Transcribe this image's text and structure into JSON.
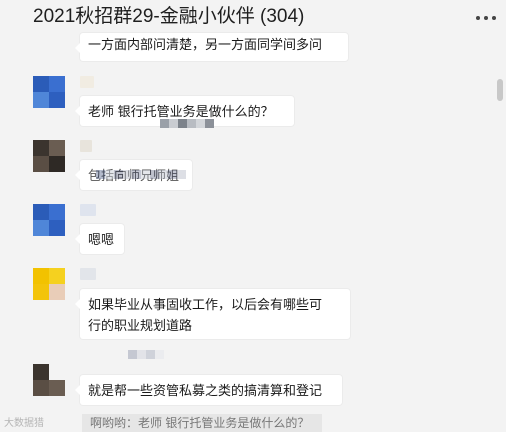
{
  "header": {
    "title": "2021秋招群29-金融小伙伴 (304)",
    "more_icon": "more-dots-icon"
  },
  "messages": [
    {
      "text": "一方面内部问清楚，另一方面同学间多问"
    },
    {
      "text": "老师 银行托管业务是做什么的？"
    },
    {
      "text": "包括向师兄师姐"
    },
    {
      "text": "嗯嗯"
    },
    {
      "text": "如果毕业从事固收工作，以后会有哪些可\n行的职业规划道路"
    },
    {
      "text": "就是帮一些资管私募之类的搞清算和登记"
    }
  ],
  "quote": {
    "text": "啊哟哟：老师 银行托管业务是做什么的？"
  },
  "watermark": {
    "text": "大数据猎"
  },
  "colors": {
    "background": "#f3f3f3",
    "bubble": "#ffffff",
    "avatar_blue": "#2d5fbf",
    "avatar_yellow": "#f2c200",
    "avatar_dark": "#3a3530"
  }
}
